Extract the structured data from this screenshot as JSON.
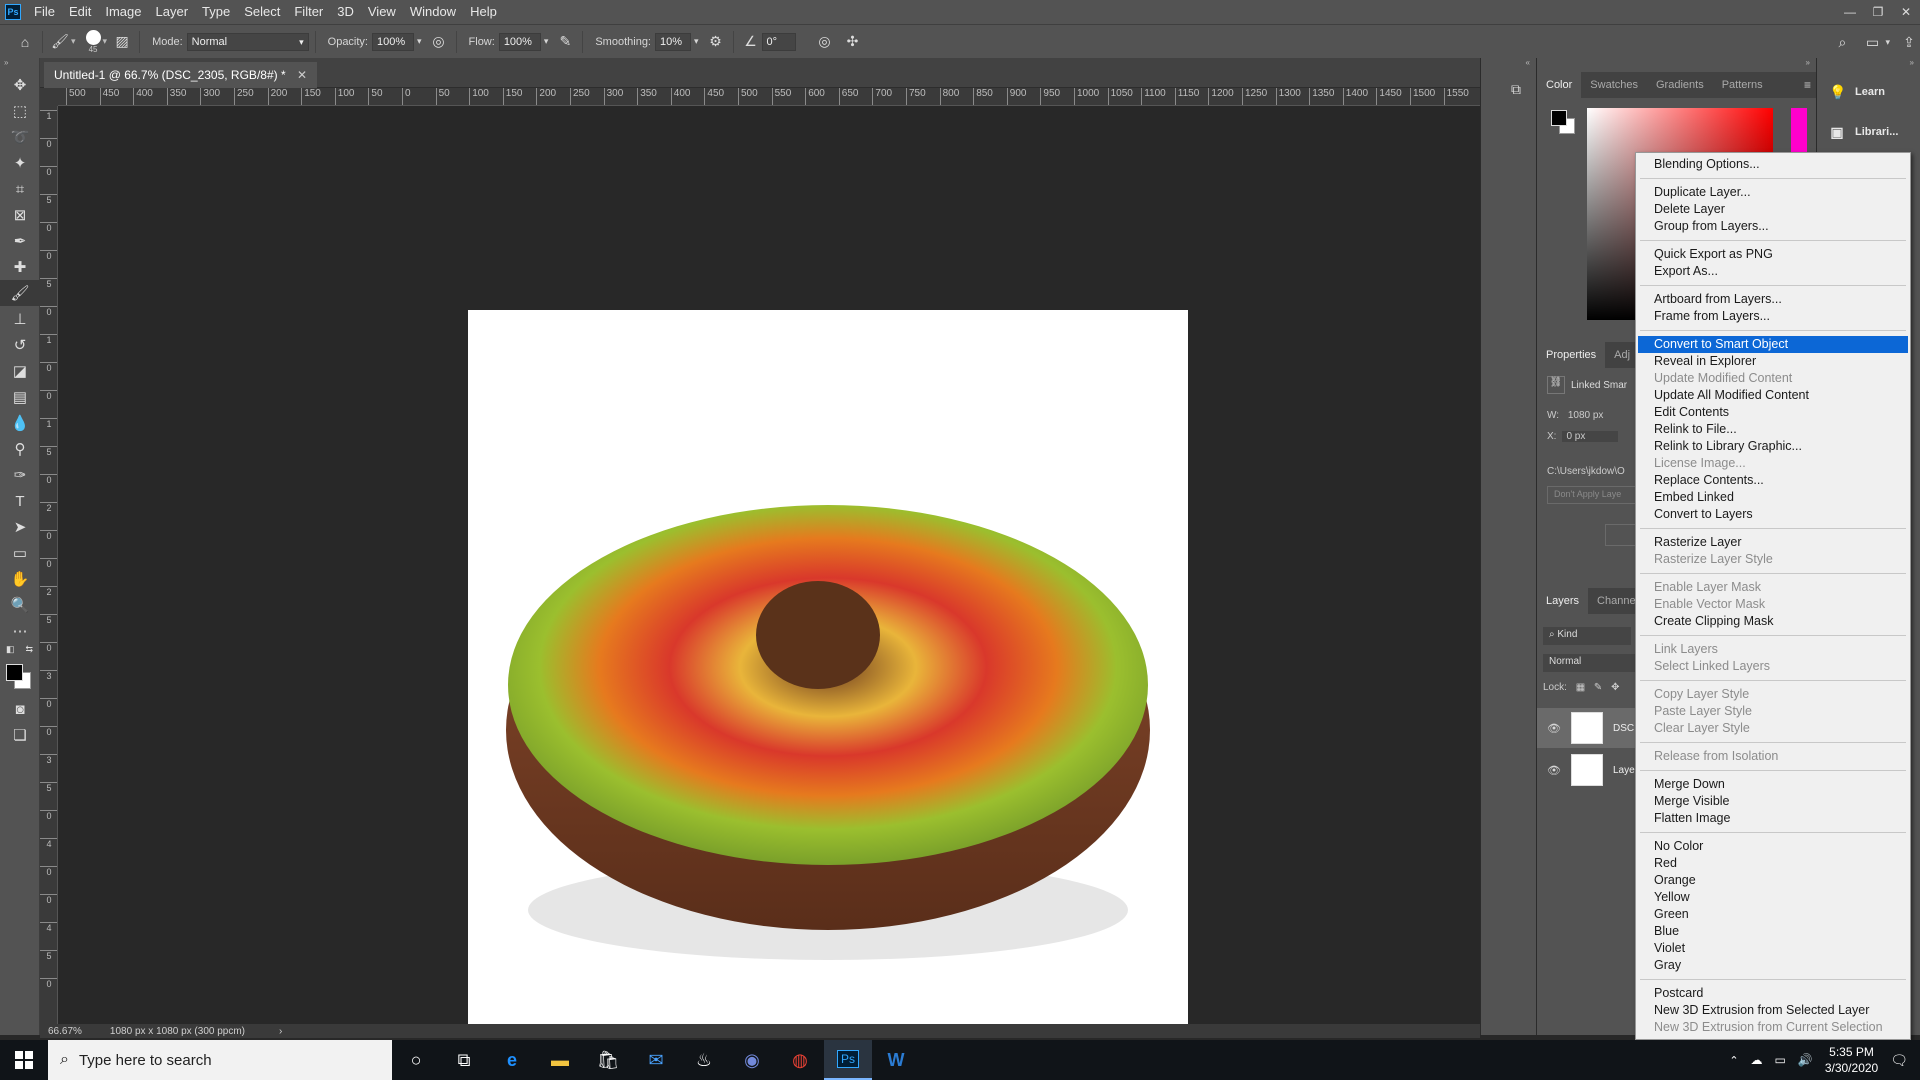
{
  "app": {
    "logo": "Ps",
    "menu": [
      "File",
      "Edit",
      "Image",
      "Layer",
      "Type",
      "Select",
      "Filter",
      "3D",
      "View",
      "Window",
      "Help"
    ],
    "window_controls": [
      "minimize-icon",
      "restore-icon",
      "close-icon"
    ]
  },
  "options_bar": {
    "brush_size": "45",
    "mode_label": "Mode:",
    "mode_value": "Normal",
    "opacity_label": "Opacity:",
    "opacity_value": "100%",
    "flow_label": "Flow:",
    "flow_value": "100%",
    "smoothing_label": "Smoothing:",
    "smoothing_value": "10%",
    "angle_value": "0°"
  },
  "document": {
    "tab_title": "Untitled-1 @ 66.7% (DSC_2305, RGB/8#) *",
    "zoom": "66.67%",
    "doc_info": "1080 px x 1080 px (300 ppcm)",
    "hruler_ticks": [
      "500",
      "450",
      "400",
      "350",
      "300",
      "250",
      "200",
      "150",
      "100",
      "50",
      "0",
      "50",
      "100",
      "150",
      "200",
      "250",
      "300",
      "350",
      "400",
      "450",
      "500",
      "550",
      "600",
      "650",
      "700",
      "750",
      "800",
      "850",
      "900",
      "950",
      "1000",
      "1050",
      "1100",
      "1150",
      "1200",
      "1250",
      "1300",
      "1350",
      "1400",
      "1450",
      "1500",
      "1550"
    ],
    "vruler_ticks": [
      "1",
      "0",
      "0",
      "5",
      "0",
      "0",
      "5",
      "0",
      "1",
      "0",
      "0",
      "1",
      "5",
      "0",
      "2",
      "0",
      "0",
      "2",
      "5",
      "0",
      "3",
      "0",
      "0",
      "3",
      "5",
      "0",
      "4",
      "0",
      "0",
      "4",
      "5",
      "0"
    ]
  },
  "panels": {
    "color_tabs": [
      "Color",
      "Swatches",
      "Gradients",
      "Patterns"
    ],
    "properties_tabs": [
      "Properties",
      "Adj"
    ],
    "properties": {
      "linked": "Linked Smar",
      "w_label": "W:",
      "w_value": "1080 px",
      "x_label": "X:",
      "x_value": "0 px",
      "path": "C:\\Users\\jkdow\\O",
      "dont_apply": "Don't Apply Laye"
    },
    "layers_tabs": [
      "Layers",
      "Channe"
    ],
    "layers": {
      "kind": "Kind",
      "blend": "Normal",
      "lock_label": "Lock:",
      "rows": [
        "DSC",
        "Laye"
      ]
    }
  },
  "side_panel": [
    "Learn",
    "Librari..."
  ],
  "context_menu": {
    "groups": [
      [
        {
          "label": "Blending Options...",
          "enabled": true
        }
      ],
      [
        {
          "label": "Duplicate Layer...",
          "enabled": true
        },
        {
          "label": "Delete Layer",
          "enabled": true
        },
        {
          "label": "Group from Layers...",
          "enabled": true
        }
      ],
      [
        {
          "label": "Quick Export as PNG",
          "enabled": true
        },
        {
          "label": "Export As...",
          "enabled": true
        }
      ],
      [
        {
          "label": "Artboard from Layers...",
          "enabled": true
        },
        {
          "label": "Frame from Layers...",
          "enabled": true
        }
      ],
      [
        {
          "label": "Convert to Smart Object",
          "enabled": true,
          "highlighted": true
        },
        {
          "label": "Reveal in Explorer",
          "enabled": true
        },
        {
          "label": "Update Modified Content",
          "enabled": false
        },
        {
          "label": "Update All Modified Content",
          "enabled": true
        },
        {
          "label": "Edit Contents",
          "enabled": true
        },
        {
          "label": "Relink to File...",
          "enabled": true
        },
        {
          "label": "Relink to Library Graphic...",
          "enabled": true
        },
        {
          "label": "License Image...",
          "enabled": false
        },
        {
          "label": "Replace Contents...",
          "enabled": true
        },
        {
          "label": "Embed Linked",
          "enabled": true
        },
        {
          "label": "Convert to Layers",
          "enabled": true
        }
      ],
      [
        {
          "label": "Rasterize Layer",
          "enabled": true
        },
        {
          "label": "Rasterize Layer Style",
          "enabled": false
        }
      ],
      [
        {
          "label": "Enable Layer Mask",
          "enabled": false
        },
        {
          "label": "Enable Vector Mask",
          "enabled": false
        },
        {
          "label": "Create Clipping Mask",
          "enabled": true
        }
      ],
      [
        {
          "label": "Link Layers",
          "enabled": false
        },
        {
          "label": "Select Linked Layers",
          "enabled": false
        }
      ],
      [
        {
          "label": "Copy Layer Style",
          "enabled": false
        },
        {
          "label": "Paste Layer Style",
          "enabled": false
        },
        {
          "label": "Clear Layer Style",
          "enabled": false
        }
      ],
      [
        {
          "label": "Release from Isolation",
          "enabled": false
        }
      ],
      [
        {
          "label": "Merge Down",
          "enabled": true
        },
        {
          "label": "Merge Visible",
          "enabled": true
        },
        {
          "label": "Flatten Image",
          "enabled": true
        }
      ],
      [
        {
          "label": "No Color",
          "enabled": true
        },
        {
          "label": "Red",
          "enabled": true
        },
        {
          "label": "Orange",
          "enabled": true
        },
        {
          "label": "Yellow",
          "enabled": true
        },
        {
          "label": "Green",
          "enabled": true
        },
        {
          "label": "Blue",
          "enabled": true
        },
        {
          "label": "Violet",
          "enabled": true
        },
        {
          "label": "Gray",
          "enabled": true
        }
      ],
      [
        {
          "label": "Postcard",
          "enabled": true
        },
        {
          "label": "New 3D Extrusion from Selected Layer",
          "enabled": true
        },
        {
          "label": "New 3D Extrusion from Current Selection",
          "enabled": false
        }
      ]
    ]
  },
  "taskbar": {
    "search_placeholder": "Type here to search",
    "time": "5:35 PM",
    "date": "3/30/2020"
  },
  "colors": {
    "highlight": "#0c67d6",
    "ps_blue": "#31a8ff"
  }
}
